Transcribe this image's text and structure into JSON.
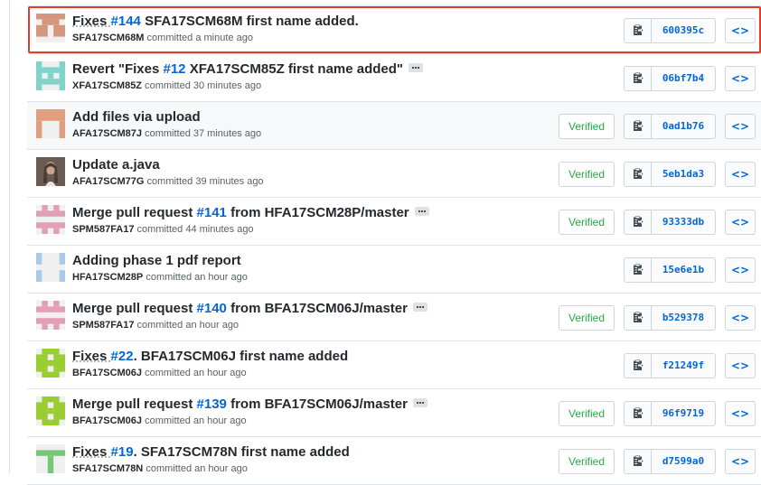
{
  "commits": [
    {
      "message_parts": [
        {
          "text": "Fixes ",
          "style": "link-plain"
        },
        {
          "text": "#144",
          "style": "issue"
        },
        {
          "text": " SFA17SCM68M first name added.",
          "style": "plain"
        }
      ],
      "author": "SFA17SCM68M",
      "committed_text": " committed a minute ago",
      "has_ellipsis": false,
      "verified": false,
      "sha": "600395c",
      "highlight": true,
      "shaded": false,
      "avatar": {
        "color": "#d4977e",
        "pattern": "fixes"
      }
    },
    {
      "message_parts": [
        {
          "text": "Revert \"Fixes ",
          "style": "plain"
        },
        {
          "text": "#12",
          "style": "issue"
        },
        {
          "text": " XFA17SCM85Z first name added\"",
          "style": "plain"
        }
      ],
      "author": "XFA17SCM85Z",
      "committed_text": " committed 30 minutes ago",
      "has_ellipsis": true,
      "verified": false,
      "sha": "06bf7b4",
      "highlight": false,
      "shaded": false,
      "avatar": {
        "color": "#7fd3c9",
        "pattern": "x"
      }
    },
    {
      "message_parts": [
        {
          "text": "Add files via upload",
          "style": "plain"
        }
      ],
      "author": "AFA17SCM87J",
      "committed_text": " committed 37 minutes ago",
      "has_ellipsis": false,
      "verified": true,
      "sha": "0ad1b76",
      "highlight": false,
      "shaded": true,
      "avatar": {
        "color": "#e0a07e",
        "pattern": "arch"
      }
    },
    {
      "message_parts": [
        {
          "text": "Update a.java",
          "style": "plain"
        }
      ],
      "author": "AFA17SCM77G",
      "committed_text": " committed 39 minutes ago",
      "has_ellipsis": false,
      "verified": true,
      "sha": "5eb1da3",
      "highlight": false,
      "shaded": false,
      "avatar": {
        "color": "#4a3b35",
        "pattern": "photo"
      }
    },
    {
      "message_parts": [
        {
          "text": "Merge pull request ",
          "style": "plain"
        },
        {
          "text": "#141",
          "style": "issue"
        },
        {
          "text": " from HFA17SCM28P/master",
          "style": "plain"
        }
      ],
      "author": "SPM587FA17",
      "committed_text": " committed 44 minutes ago",
      "has_ellipsis": true,
      "verified": true,
      "sha": "93333db",
      "highlight": false,
      "shaded": false,
      "avatar": {
        "color": "#e3a0b4",
        "pattern": "cross"
      }
    },
    {
      "message_parts": [
        {
          "text": "Adding phase 1 pdf report",
          "style": "plain"
        }
      ],
      "author": "HFA17SCM28P",
      "committed_text": " committed an hour ago",
      "has_ellipsis": false,
      "verified": false,
      "sha": "15e6e1b",
      "highlight": false,
      "shaded": false,
      "avatar": {
        "color": "#a9c9ea",
        "pattern": "dots"
      }
    },
    {
      "message_parts": [
        {
          "text": "Merge pull request ",
          "style": "plain"
        },
        {
          "text": "#140",
          "style": "issue"
        },
        {
          "text": " from BFA17SCM06J/master",
          "style": "plain"
        }
      ],
      "author": "SPM587FA17",
      "committed_text": " committed an hour ago",
      "has_ellipsis": true,
      "verified": true,
      "sha": "b529378",
      "highlight": false,
      "shaded": false,
      "avatar": {
        "color": "#e3a0b4",
        "pattern": "cross"
      }
    },
    {
      "message_parts": [
        {
          "text": "Fixes ",
          "style": "link-plain"
        },
        {
          "text": "#22",
          "style": "issue"
        },
        {
          "text": ". BFA17SCM06J first name added",
          "style": "plain"
        }
      ],
      "author": "BFA17SCM06J",
      "committed_text": " committed an hour ago",
      "has_ellipsis": false,
      "verified": false,
      "sha": "f21249f",
      "highlight": false,
      "shaded": false,
      "avatar": {
        "color": "#9acd32",
        "pattern": "plus"
      }
    },
    {
      "message_parts": [
        {
          "text": "Merge pull request ",
          "style": "plain"
        },
        {
          "text": "#139",
          "style": "issue"
        },
        {
          "text": " from BFA17SCM06J/master",
          "style": "plain"
        }
      ],
      "author": "BFA17SCM06J",
      "committed_text": " committed an hour ago",
      "has_ellipsis": true,
      "verified": true,
      "sha": "96f9719",
      "highlight": false,
      "shaded": false,
      "avatar": {
        "color": "#9acd32",
        "pattern": "plus"
      }
    },
    {
      "message_parts": [
        {
          "text": "Fixes ",
          "style": "link-plain"
        },
        {
          "text": "#19",
          "style": "issue"
        },
        {
          "text": ". SFA17SCM78N first name added",
          "style": "plain"
        }
      ],
      "author": "SFA17SCM78N",
      "committed_text": " committed an hour ago",
      "has_ellipsis": false,
      "verified": true,
      "sha": "d7599a0",
      "highlight": false,
      "shaded": false,
      "avatar": {
        "color": "#76c776",
        "pattern": "t"
      }
    }
  ],
  "labels": {
    "verified": "Verified",
    "browse": "<>"
  },
  "colors": {
    "link": "#0366d6",
    "verified": "#28a745",
    "highlight_border": "#e23d28"
  }
}
